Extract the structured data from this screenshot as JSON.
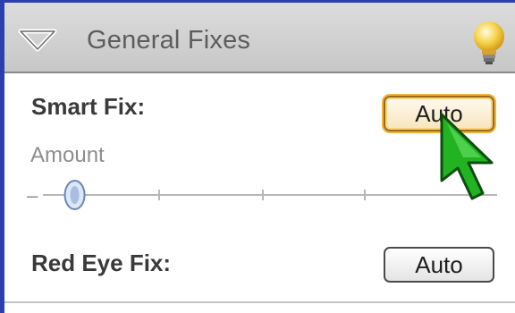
{
  "panel": {
    "title": "General Fixes",
    "collapse_icon": "triangle-down-icon",
    "tip_icon": "lightbulb-icon"
  },
  "smart_fix": {
    "label": "Smart Fix:",
    "button_label": "Auto",
    "amount_label": "Amount",
    "amount_minus": "–",
    "amount_value": 0.07
  },
  "red_eye_fix": {
    "label": "Red Eye Fix:",
    "button_label": "Auto"
  },
  "cursor": {
    "icon": "green-arrow-cursor-icon"
  },
  "colors": {
    "frame_border": "#2a3fb0",
    "header_bg": "#c7c7c7",
    "focus_ring": "#f1b53a",
    "cursor_green": "#22b322",
    "bulb_yellow": "#f6d34a"
  }
}
